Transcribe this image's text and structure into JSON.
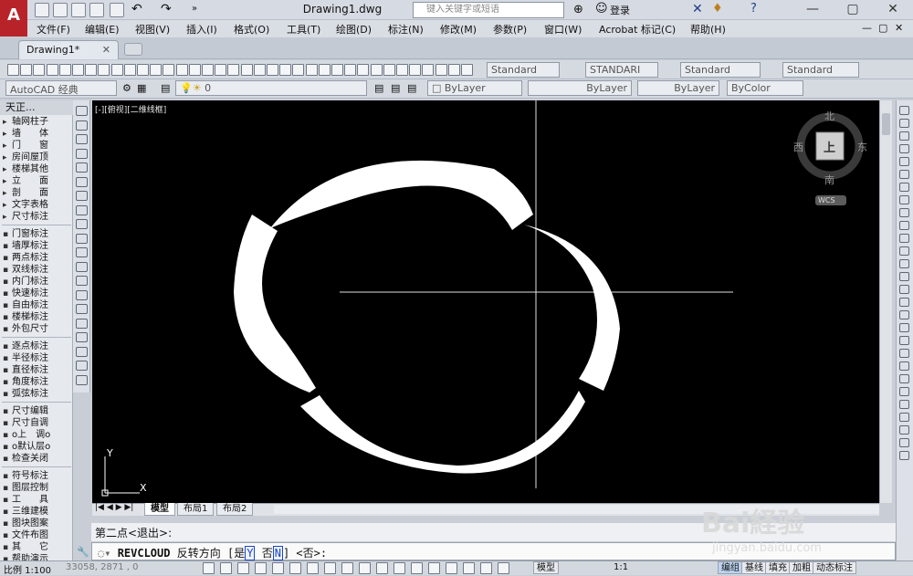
{
  "app": {
    "logo_letter": "A",
    "title": "Drawing1.dwg",
    "search_placeholder": "键入关键字或短语",
    "login_label": "登录"
  },
  "menu": [
    "文件(F)",
    "编辑(E)",
    "视图(V)",
    "插入(I)",
    "格式(O)",
    "工具(T)",
    "绘图(D)",
    "标注(N)",
    "修改(M)",
    "参数(P)",
    "窗口(W)",
    "Acrobat 标记(C)",
    "帮助(H)"
  ],
  "doc_tab": {
    "label": "Drawing1*"
  },
  "styles": {
    "text_style": "Standard",
    "dim_style": "STANDARI",
    "table_style": "Standard",
    "mleader_style": "Standard"
  },
  "workspace": "AutoCAD 经典",
  "layer": {
    "current": "0"
  },
  "properties": {
    "color": "ByLayer",
    "linetype": "ByLayer",
    "lineweight": "ByLayer",
    "plot_style": "ByColor"
  },
  "palette": {
    "title": "天正...",
    "groups": [
      [
        "轴网柱子",
        "墙　　体",
        "门　　窗",
        "房间屋顶",
        "楼梯其他",
        "立　　面",
        "剖　　面",
        "文字表格",
        "尺寸标注"
      ],
      [
        "门窗标注",
        "墙厚标注",
        "两点标注",
        "双线标注",
        "内门标注",
        "快速标注",
        "自由标注",
        "楼梯标注",
        "外包尺寸"
      ],
      [
        "逐点标注",
        "半径标注",
        "直径标注",
        "角度标注",
        "弧弦标注"
      ],
      [
        "尺寸编辑",
        "尺寸自调",
        "o上　调o",
        "o默认层o",
        "检查关闭"
      ],
      [
        "符号标注",
        "图层控制",
        "工　　具",
        "三维建模",
        "图块图案",
        "文件布图",
        "其　　它",
        "帮助演示"
      ]
    ]
  },
  "viewport_label": "[-][俯视][二维线框]",
  "viewcube": {
    "north": "北",
    "south": "南",
    "east": "东",
    "west": "西",
    "top": "上",
    "wcs": "WCS"
  },
  "ucs": {
    "x": "X",
    "y": "Y"
  },
  "layout_tabs": [
    "模型",
    "布局1",
    "布局2"
  ],
  "command": {
    "history": "第二点<退出>:",
    "name": "REVCLOUD",
    "prompt": "反转方向",
    "options_open": "[",
    "opt_yes": "是",
    "opt_yes_key": "Y",
    "opt_no": "否",
    "opt_no_key": "N",
    "options_close": "]",
    "default": "<否>:"
  },
  "status": {
    "scale": "比例 1:100",
    "coords": "33058, 2871 , 0",
    "buttons": [
      "模型",
      "编组",
      "基线",
      "填充",
      "加粗",
      "动态标注"
    ],
    "annotation_scale": "1:1"
  },
  "watermark": {
    "logo": "Bai経验",
    "url": "jingyan.baidu.com"
  }
}
